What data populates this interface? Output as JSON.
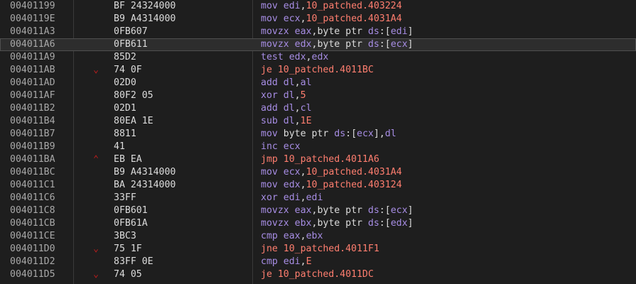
{
  "disassembly": {
    "rows": [
      {
        "addr": "00401199",
        "arrow": "",
        "bytes": "BF 24324000",
        "tokens": [
          {
            "t": "mov",
            "c": "op"
          },
          {
            "t": " ",
            "c": "punc"
          },
          {
            "t": "edi",
            "c": "op"
          },
          {
            "t": ",",
            "c": "punc"
          },
          {
            "t": "10_patched.403224",
            "c": "sym"
          }
        ]
      },
      {
        "addr": "0040119E",
        "arrow": "",
        "bytes": "B9 A4314000",
        "tokens": [
          {
            "t": "mov",
            "c": "op"
          },
          {
            "t": " ",
            "c": "punc"
          },
          {
            "t": "ecx",
            "c": "op"
          },
          {
            "t": ",",
            "c": "punc"
          },
          {
            "t": "10_patched.4031A4",
            "c": "sym"
          }
        ]
      },
      {
        "addr": "004011A3",
        "arrow": "",
        "bytes": "0FB607",
        "tokens": [
          {
            "t": "movzx",
            "c": "op"
          },
          {
            "t": " ",
            "c": "punc"
          },
          {
            "t": "eax",
            "c": "op"
          },
          {
            "t": ",",
            "c": "punc"
          },
          {
            "t": "byte ptr ",
            "c": "kw"
          },
          {
            "t": "ds",
            "c": "op"
          },
          {
            "t": ":[",
            "c": "punc"
          },
          {
            "t": "edi",
            "c": "op"
          },
          {
            "t": "]",
            "c": "punc"
          }
        ]
      },
      {
        "addr": "004011A6",
        "arrow": "",
        "bytes": "0FB611",
        "selected": true,
        "tokens": [
          {
            "t": "movzx",
            "c": "op"
          },
          {
            "t": " ",
            "c": "punc"
          },
          {
            "t": "edx",
            "c": "op"
          },
          {
            "t": ",",
            "c": "punc"
          },
          {
            "t": "byte ptr ",
            "c": "kw"
          },
          {
            "t": "ds",
            "c": "op"
          },
          {
            "t": ":[",
            "c": "punc"
          },
          {
            "t": "ecx",
            "c": "op"
          },
          {
            "t": "]",
            "c": "punc"
          }
        ]
      },
      {
        "addr": "004011A9",
        "arrow": "",
        "bytes": "85D2",
        "tokens": [
          {
            "t": "test",
            "c": "op"
          },
          {
            "t": " ",
            "c": "punc"
          },
          {
            "t": "edx",
            "c": "op"
          },
          {
            "t": ",",
            "c": "punc"
          },
          {
            "t": "edx",
            "c": "op"
          }
        ]
      },
      {
        "addr": "004011AB",
        "arrow": "down",
        "bytes": "74 0F",
        "tokens": [
          {
            "t": "je",
            "c": "sym"
          },
          {
            "t": " ",
            "c": "punc"
          },
          {
            "t": "10_patched.4011BC",
            "c": "sym"
          }
        ]
      },
      {
        "addr": "004011AD",
        "arrow": "",
        "bytes": "02D0",
        "tokens": [
          {
            "t": "add",
            "c": "op"
          },
          {
            "t": " ",
            "c": "punc"
          },
          {
            "t": "dl",
            "c": "op"
          },
          {
            "t": ",",
            "c": "punc"
          },
          {
            "t": "al",
            "c": "op"
          }
        ]
      },
      {
        "addr": "004011AF",
        "arrow": "",
        "bytes": "80F2 05",
        "tokens": [
          {
            "t": "xor",
            "c": "op"
          },
          {
            "t": " ",
            "c": "punc"
          },
          {
            "t": "dl",
            "c": "op"
          },
          {
            "t": ",",
            "c": "punc"
          },
          {
            "t": "5",
            "c": "num"
          }
        ]
      },
      {
        "addr": "004011B2",
        "arrow": "",
        "bytes": "02D1",
        "tokens": [
          {
            "t": "add",
            "c": "op"
          },
          {
            "t": " ",
            "c": "punc"
          },
          {
            "t": "dl",
            "c": "op"
          },
          {
            "t": ",",
            "c": "punc"
          },
          {
            "t": "cl",
            "c": "op"
          }
        ]
      },
      {
        "addr": "004011B4",
        "arrow": "",
        "bytes": "80EA 1E",
        "tokens": [
          {
            "t": "sub",
            "c": "op"
          },
          {
            "t": " ",
            "c": "punc"
          },
          {
            "t": "dl",
            "c": "op"
          },
          {
            "t": ",",
            "c": "punc"
          },
          {
            "t": "1E",
            "c": "num"
          }
        ]
      },
      {
        "addr": "004011B7",
        "arrow": "",
        "bytes": "8811",
        "tokens": [
          {
            "t": "mov",
            "c": "op"
          },
          {
            "t": " ",
            "c": "punc"
          },
          {
            "t": "byte ptr ",
            "c": "kw"
          },
          {
            "t": "ds",
            "c": "op"
          },
          {
            "t": ":[",
            "c": "punc"
          },
          {
            "t": "ecx",
            "c": "op"
          },
          {
            "t": "],",
            "c": "punc"
          },
          {
            "t": "dl",
            "c": "op"
          }
        ]
      },
      {
        "addr": "004011B9",
        "arrow": "",
        "bytes": "41",
        "tokens": [
          {
            "t": "inc",
            "c": "op"
          },
          {
            "t": " ",
            "c": "punc"
          },
          {
            "t": "ecx",
            "c": "op"
          }
        ]
      },
      {
        "addr": "004011BA",
        "arrow": "up",
        "bytes": "EB EA",
        "tokens": [
          {
            "t": "jmp",
            "c": "sym"
          },
          {
            "t": " ",
            "c": "punc"
          },
          {
            "t": "10_patched.4011A6",
            "c": "sym"
          }
        ]
      },
      {
        "addr": "004011BC",
        "arrow": "",
        "bytes": "B9 A4314000",
        "tokens": [
          {
            "t": "mov",
            "c": "op"
          },
          {
            "t": " ",
            "c": "punc"
          },
          {
            "t": "ecx",
            "c": "op"
          },
          {
            "t": ",",
            "c": "punc"
          },
          {
            "t": "10_patched.4031A4",
            "c": "sym"
          }
        ]
      },
      {
        "addr": "004011C1",
        "arrow": "",
        "bytes": "BA 24314000",
        "tokens": [
          {
            "t": "mov",
            "c": "op"
          },
          {
            "t": " ",
            "c": "punc"
          },
          {
            "t": "edx",
            "c": "op"
          },
          {
            "t": ",",
            "c": "punc"
          },
          {
            "t": "10_patched.403124",
            "c": "sym"
          }
        ]
      },
      {
        "addr": "004011C6",
        "arrow": "",
        "bytes": "33FF",
        "tokens": [
          {
            "t": "xor",
            "c": "op"
          },
          {
            "t": " ",
            "c": "punc"
          },
          {
            "t": "edi",
            "c": "op"
          },
          {
            "t": ",",
            "c": "punc"
          },
          {
            "t": "edi",
            "c": "op"
          }
        ]
      },
      {
        "addr": "004011C8",
        "arrow": "",
        "bytes": "0FB601",
        "tokens": [
          {
            "t": "movzx",
            "c": "op"
          },
          {
            "t": " ",
            "c": "punc"
          },
          {
            "t": "eax",
            "c": "op"
          },
          {
            "t": ",",
            "c": "punc"
          },
          {
            "t": "byte ptr ",
            "c": "kw"
          },
          {
            "t": "ds",
            "c": "op"
          },
          {
            "t": ":[",
            "c": "punc"
          },
          {
            "t": "ecx",
            "c": "op"
          },
          {
            "t": "]",
            "c": "punc"
          }
        ]
      },
      {
        "addr": "004011CB",
        "arrow": "",
        "bytes": "0FB61A",
        "tokens": [
          {
            "t": "movzx",
            "c": "op"
          },
          {
            "t": " ",
            "c": "punc"
          },
          {
            "t": "ebx",
            "c": "op"
          },
          {
            "t": ",",
            "c": "punc"
          },
          {
            "t": "byte ptr ",
            "c": "kw"
          },
          {
            "t": "ds",
            "c": "op"
          },
          {
            "t": ":[",
            "c": "punc"
          },
          {
            "t": "edx",
            "c": "op"
          },
          {
            "t": "]",
            "c": "punc"
          }
        ]
      },
      {
        "addr": "004011CE",
        "arrow": "",
        "bytes": "3BC3",
        "tokens": [
          {
            "t": "cmp",
            "c": "op"
          },
          {
            "t": " ",
            "c": "punc"
          },
          {
            "t": "eax",
            "c": "op"
          },
          {
            "t": ",",
            "c": "punc"
          },
          {
            "t": "ebx",
            "c": "op"
          }
        ]
      },
      {
        "addr": "004011D0",
        "arrow": "down",
        "bytes": "75 1F",
        "tokens": [
          {
            "t": "jne",
            "c": "sym"
          },
          {
            "t": " ",
            "c": "punc"
          },
          {
            "t": "10_patched.4011F1",
            "c": "sym"
          }
        ]
      },
      {
        "addr": "004011D2",
        "arrow": "",
        "bytes": "83FF 0E",
        "tokens": [
          {
            "t": "cmp",
            "c": "op"
          },
          {
            "t": " ",
            "c": "punc"
          },
          {
            "t": "edi",
            "c": "op"
          },
          {
            "t": ",",
            "c": "punc"
          },
          {
            "t": "E",
            "c": "num"
          }
        ]
      },
      {
        "addr": "004011D5",
        "arrow": "down",
        "bytes": "74 05",
        "tokens": [
          {
            "t": "je",
            "c": "sym"
          },
          {
            "t": " ",
            "c": "punc"
          },
          {
            "t": "10_patched.4011DC",
            "c": "sym"
          }
        ]
      }
    ],
    "arrow_glyphs": {
      "down": "⌄",
      "up": "⌃"
    },
    "colors": {
      "background": "#1e1e1e",
      "address": "#a8a8a8",
      "register": "#a78de4",
      "symbol": "#ff7e6f",
      "text": "#dcdcdc",
      "arrow": "#c41d1d",
      "selected_row": "#2d2d2d"
    }
  }
}
